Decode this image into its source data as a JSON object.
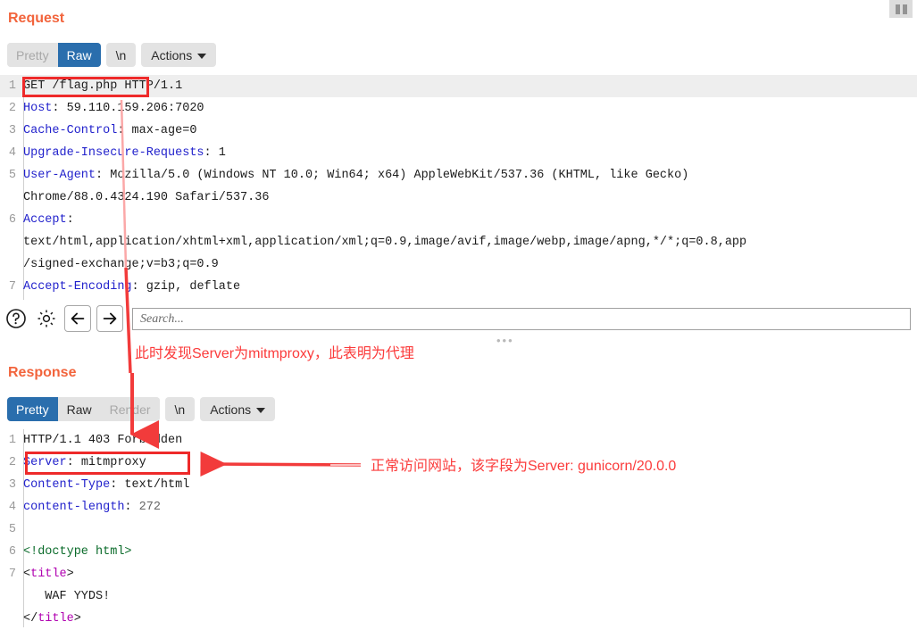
{
  "request": {
    "title": "Request",
    "tabs": [
      {
        "label": "Pretty",
        "state": "disabled"
      },
      {
        "label": "Raw",
        "state": "selected"
      }
    ],
    "newline_label": "\\n",
    "actions_label": "Actions",
    "lines": [
      {
        "n": "1",
        "highlight": true,
        "parts": [
          {
            "t": "GET /flag.php HTTP/1.1",
            "c": "plain"
          }
        ]
      },
      {
        "n": "2",
        "parts": [
          {
            "t": "Host",
            "c": "hdr"
          },
          {
            "t": ": ",
            "c": "plain"
          },
          {
            "t": "59.110.159.206:7020",
            "c": "val"
          }
        ]
      },
      {
        "n": "3",
        "parts": [
          {
            "t": "Cache-Control",
            "c": "hdr"
          },
          {
            "t": ": ",
            "c": "plain"
          },
          {
            "t": "max-age=0",
            "c": "val"
          }
        ]
      },
      {
        "n": "4",
        "parts": [
          {
            "t": "Upgrade-Insecure-Requests",
            "c": "hdr"
          },
          {
            "t": ": ",
            "c": "plain"
          },
          {
            "t": "1",
            "c": "val"
          }
        ]
      },
      {
        "n": "5",
        "parts": [
          {
            "t": "User-Agent",
            "c": "hdr"
          },
          {
            "t": ": ",
            "c": "plain"
          },
          {
            "t": "Mozilla/5.0 (Windows NT 10.0; Win64; x64) AppleWebKit/537.36 (KHTML, like Gecko)",
            "c": "val"
          }
        ]
      },
      {
        "n": "",
        "parts": [
          {
            "t": "Chrome/88.0.4324.190 Safari/537.36",
            "c": "val"
          }
        ]
      },
      {
        "n": "6",
        "parts": [
          {
            "t": "Accept",
            "c": "hdr"
          },
          {
            "t": ":",
            "c": "plain"
          }
        ]
      },
      {
        "n": "",
        "parts": [
          {
            "t": "text/html,application/xhtml+xml,application/xml;q=0.9,image/avif,image/webp,image/apng,*/*;q=0.8,app",
            "c": "val"
          }
        ]
      },
      {
        "n": "",
        "parts": [
          {
            "t": "/signed-exchange;v=b3;q=0.9",
            "c": "val"
          }
        ]
      },
      {
        "n": "7",
        "parts": [
          {
            "t": "Accept-Encoding",
            "c": "hdr"
          },
          {
            "t": ": ",
            "c": "plain"
          },
          {
            "t": "gzip, deflate",
            "c": "val"
          }
        ]
      }
    ]
  },
  "search": {
    "placeholder": "Search...",
    "value": "",
    "help_icon": "question-mark-circle-icon",
    "settings_icon": "gear-icon",
    "prev_icon": "arrow-left-icon",
    "next_icon": "arrow-right-icon"
  },
  "response": {
    "title": "Response",
    "tabs": [
      {
        "label": "Pretty",
        "state": "selected"
      },
      {
        "label": "Raw",
        "state": "normal"
      },
      {
        "label": "Render",
        "state": "disabled"
      }
    ],
    "newline_label": "\\n",
    "actions_label": "Actions",
    "lines": [
      {
        "n": "1",
        "parts": [
          {
            "t": "HTTP/1.1 403 Forbidden",
            "c": "plain"
          }
        ]
      },
      {
        "n": "2",
        "parts": [
          {
            "t": "Server",
            "c": "hdr"
          },
          {
            "t": ": ",
            "c": "plain"
          },
          {
            "t": "mitmproxy",
            "c": "val"
          }
        ]
      },
      {
        "n": "3",
        "parts": [
          {
            "t": "Content-Type",
            "c": "hdr"
          },
          {
            "t": ": ",
            "c": "plain"
          },
          {
            "t": "text/html",
            "c": "val"
          }
        ]
      },
      {
        "n": "4",
        "parts": [
          {
            "t": "content-length",
            "c": "hdr"
          },
          {
            "t": ": ",
            "c": "plain"
          },
          {
            "t": "272",
            "c": "num"
          }
        ]
      },
      {
        "n": "5",
        "parts": [
          {
            "t": "",
            "c": "plain"
          }
        ]
      },
      {
        "n": "6",
        "parts": [
          {
            "t": "<!doctype html>",
            "c": "doctype"
          }
        ]
      },
      {
        "n": "7",
        "parts": [
          {
            "t": "<",
            "c": "plain"
          },
          {
            "t": "title",
            "c": "tagv"
          },
          {
            "t": ">",
            "c": "plain"
          }
        ]
      },
      {
        "n": "",
        "parts": [
          {
            "t": "   WAF YYDS!",
            "c": "plain"
          }
        ]
      },
      {
        "n": "",
        "parts": [
          {
            "t": "</",
            "c": "plain"
          },
          {
            "t": "title",
            "c": "tagv"
          },
          {
            "t": ">",
            "c": "plain"
          }
        ]
      }
    ]
  },
  "annotations": {
    "proxy_note": "此时发现Server为mitmproxy，此表明为代理",
    "proxy_note_ellipsis": "•••",
    "server_note": "正常访问网站，该字段为Server: gunicorn/20.0.0"
  },
  "colors": {
    "accent_orange": "#f2643c",
    "tab_selected": "#2a6ead",
    "annotation_red": "#fb3b3b",
    "highlight_red": "#ee2a2a",
    "header_blue": "#2222cc"
  }
}
